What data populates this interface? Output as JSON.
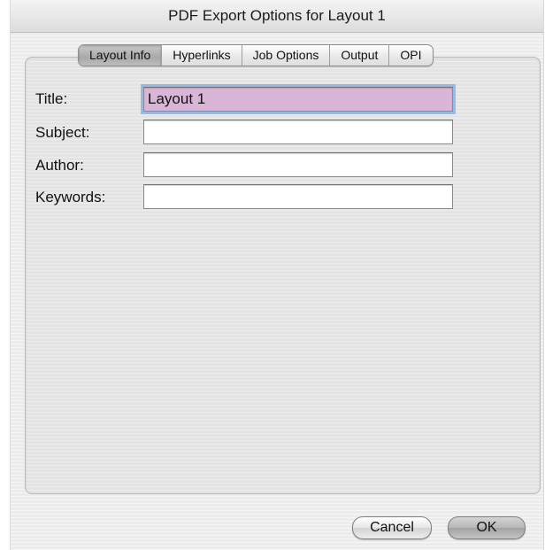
{
  "window": {
    "title": "PDF Export Options for Layout 1"
  },
  "tabs": [
    {
      "label": "Layout Info",
      "active": true
    },
    {
      "label": "Hyperlinks",
      "active": false
    },
    {
      "label": "Job Options",
      "active": false
    },
    {
      "label": "Output",
      "active": false
    },
    {
      "label": "OPI",
      "active": false
    }
  ],
  "form": {
    "title": {
      "label": "Title:",
      "value": "Layout 1"
    },
    "subject": {
      "label": "Subject:",
      "value": ""
    },
    "author": {
      "label": "Author:",
      "value": ""
    },
    "keywords": {
      "label": "Keywords:",
      "value": ""
    }
  },
  "buttons": {
    "cancel": "Cancel",
    "ok": "OK"
  },
  "colors": {
    "focused_field_bg": "#d9b5d8",
    "focus_ring": "#9bb8dd"
  }
}
